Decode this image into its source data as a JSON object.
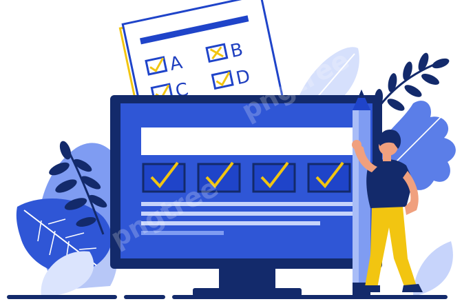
{
  "colors": {
    "primary_blue": "#1f44c9",
    "navy": "#132a6b",
    "light_blue": "#7f9cf2",
    "pale_blue": "#c7d4fb",
    "screen_blue": "#2f56d6",
    "yellow": "#f2c511",
    "skin": "#f0a07e",
    "background": "#ffffff"
  },
  "answer_sheet": {
    "options": [
      {
        "letter": "A",
        "mark": "check-icon"
      },
      {
        "letter": "B",
        "mark": "cross-icon"
      },
      {
        "letter": "C",
        "mark": "check-icon"
      },
      {
        "letter": "D",
        "mark": "check-icon"
      }
    ]
  },
  "monitor": {
    "checkbox_count": 4,
    "checkbox_icon": "check-icon"
  },
  "watermark": "pngtree"
}
